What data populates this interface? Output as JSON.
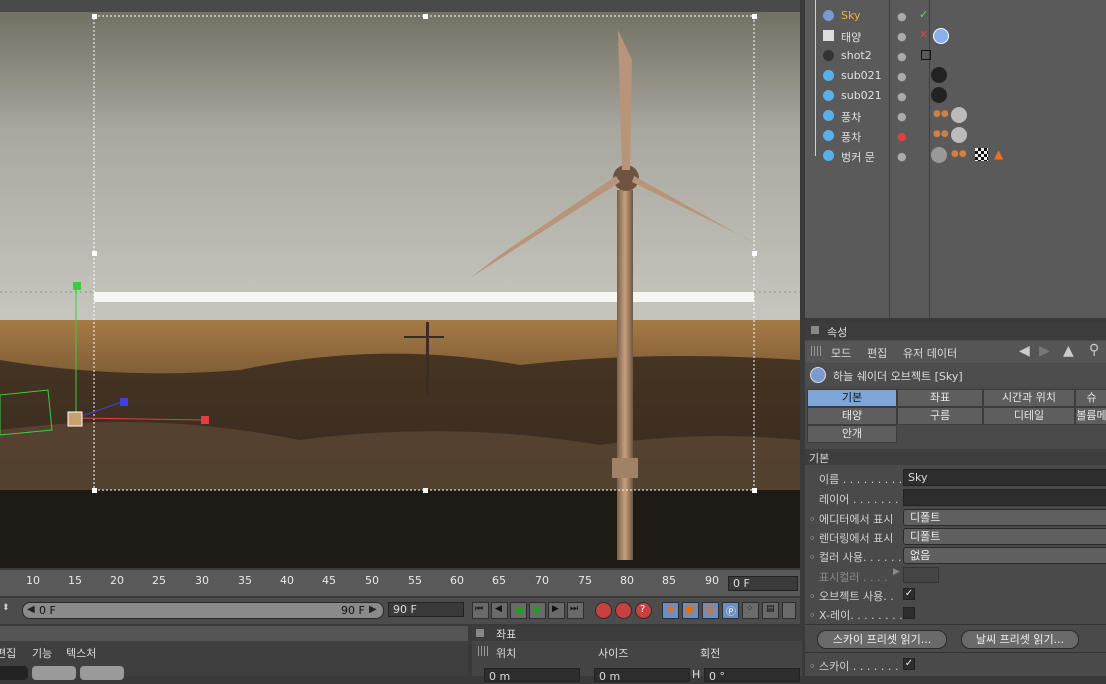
{
  "viewport": {
    "description_icons": [
      "camera-frame",
      "wind-turbine",
      "power-pole"
    ]
  },
  "object_manager": {
    "objects": [
      {
        "name": "Sky",
        "color": "#f0b040",
        "icon": "sky-icon",
        "check": "✓"
      },
      {
        "name": "태양",
        "color": "#e0e0e0",
        "icon": "light-icon",
        "check": "✕"
      },
      {
        "name": "shot2",
        "color": "#e0e0e0",
        "icon": "camera-icon",
        "check": ""
      },
      {
        "name": "sub021",
        "color": "#e0e0e0",
        "icon": "polygon-icon",
        "check": ""
      },
      {
        "name": "sub021",
        "color": "#e0e0e0",
        "icon": "polygon-icon",
        "check": ""
      },
      {
        "name": "풍차",
        "color": "#e0e0e0",
        "icon": "polygon-icon",
        "check": ""
      },
      {
        "name": "풍차",
        "color": "#e0e0e0",
        "icon": "polygon-icon",
        "check": ""
      },
      {
        "name": "벙커 문",
        "color": "#e0e0e0",
        "icon": "polygon-icon",
        "check": ""
      }
    ]
  },
  "attributes": {
    "panel_title": "속성",
    "menu": [
      "모드",
      "편집",
      "유저 데이터"
    ],
    "object_title": "하늘 쉐이더 오브젝트 [Sky]",
    "tabs_row1": [
      "기본",
      "좌표",
      "시간과 위치",
      "슈"
    ],
    "tabs_row2": [
      "태양",
      "구름",
      "디테일",
      "볼륨메"
    ],
    "tabs_row3": [
      "안개"
    ],
    "section": "기본",
    "name_label": "이름 . . . . . . . . . . .",
    "name_value": "Sky",
    "layer_label": "레이어 . . . . . . . . .",
    "editor_label": "에디터에서 표시",
    "editor_value": "디폴트",
    "render_label": "렌더링에서 표시",
    "render_value": "디폴트",
    "color_use_label": "컬러 사용. . . . . .",
    "color_use_value": "없음",
    "display_color_label": "표시컬러 . . . .",
    "object_use_label": "오브젝트 사용. .",
    "xray_label": "X-레이. . . . . . . .",
    "sky_preset_btn": "스카이 프리셋 읽기...",
    "weather_preset_btn": "날씨 프리셋 읽기...",
    "sky_label": "스카이 . . . . . . . ."
  },
  "timeline": {
    "ticks": [
      "10",
      "15",
      "20",
      "25",
      "30",
      "35",
      "40",
      "45",
      "50",
      "55",
      "60",
      "65",
      "70",
      "75",
      "80",
      "85",
      "90"
    ],
    "current_frame": "0 F",
    "range_start": "0 F",
    "range_end": "90 F",
    "end_field": "90 F"
  },
  "material_panel": {
    "menu": [
      "편집",
      "기능",
      "텍스처"
    ]
  },
  "coord_panel": {
    "title": "좌표",
    "cols": [
      "위치",
      "사이즈",
      "회전"
    ],
    "x_pos": "0 m",
    "x_size": "0 m",
    "h_label": "H",
    "h_rot": "0 °"
  }
}
